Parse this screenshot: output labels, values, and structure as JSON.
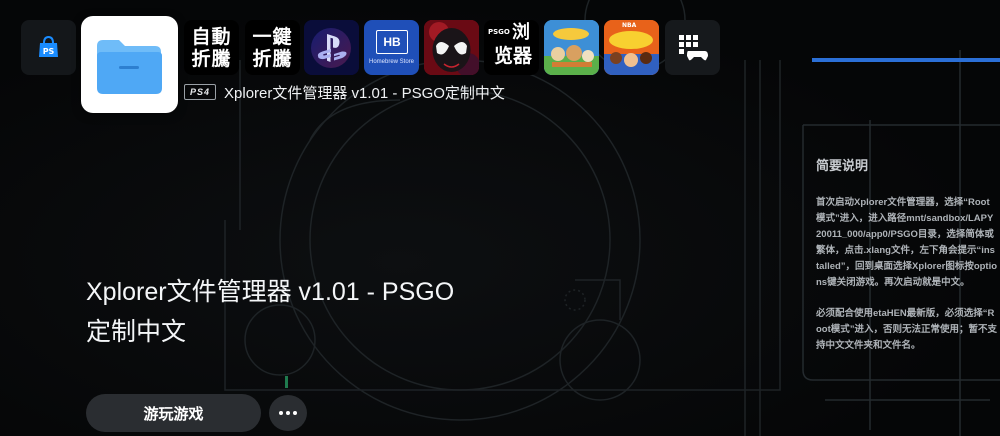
{
  "hub": {
    "tiles": [
      {
        "name": "playstation-store",
        "icon": "shopping-bag-icon"
      },
      {
        "name": "xplorer",
        "icon": "folder-icon",
        "selected": true
      },
      {
        "name": "zidong-zheteng",
        "text_line1": "自動",
        "text_line2": "折騰"
      },
      {
        "name": "yijian-zheteng",
        "text_line1": "一鍵",
        "text_line2": "折騰"
      },
      {
        "name": "playstation",
        "icon": "ps-logo-icon"
      },
      {
        "name": "homebrew-store",
        "badge": "HB",
        "caption": "Homebrew Store"
      },
      {
        "name": "spider-man",
        "icon": "spider-mask-icon"
      },
      {
        "name": "psgo-browser",
        "prefix": "PSGO",
        "text_line1": "浏",
        "text_line2": "览器"
      },
      {
        "name": "sackboy",
        "icon": "game-art-icon"
      },
      {
        "name": "nba-playgrounds",
        "prefix": "NBA",
        "icon": "game-art-icon"
      },
      {
        "name": "game-library",
        "icon": "library-grid-icon"
      }
    ]
  },
  "selected_app": {
    "platform_badge": "PS4",
    "subtitle": "Xplorer文件管理器 v1.01 - PSGO定制中文",
    "title_line1": "Xplorer文件管理器 v1.01 - PSGO",
    "title_line2": "定制中文",
    "play_button": "游玩游戏",
    "more_button_icon": "more-dots-icon"
  },
  "info_panel": {
    "heading": "简要说明",
    "paragraph1": "首次启动Xplorer文件管理器，选择“Root模式”进入，进入路径mnt/sandbox/LAPY20011_000/app0/PSGO目录，选择简体或繁体，点击.xlang文件，左下角会提示“installed”，回到桌面选择Xplorer图标按options键关闭游戏。再次启动就是中文。",
    "paragraph2": "必须配合使用etaHEN最新版，必须选择“Root模式”进入，否则无法正常使用；暂不支持中文文件夹和文件名。"
  },
  "colors": {
    "background": "#050607",
    "accent_blue": "#2b6fd6",
    "button_bg": "#2a2d31",
    "folder_blue": "#4fa8f5"
  }
}
